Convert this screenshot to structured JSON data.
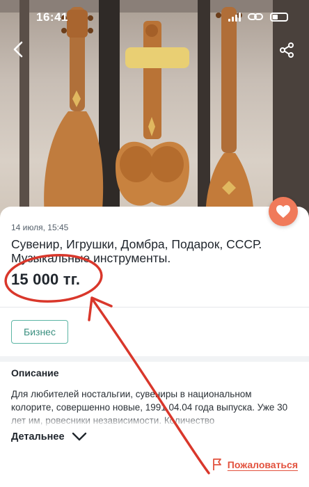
{
  "status_bar": {
    "time": "16:41"
  },
  "listing": {
    "date": "14 июля, 15:45",
    "title": "Сувенир, Игрушки, Домбра, Подарок, СССР. Музыкальные инструменты.",
    "price": "15 000 тг.",
    "badge": "Бизнес"
  },
  "description": {
    "heading": "Описание",
    "text": "Для любителей ностальгии, сувениры в национальном колорите, совершенно новые, 1991.04.04 года выпуска. Уже 30 лет им, ровесники независимости. Количество",
    "more_label": "Детальнее"
  },
  "report": {
    "label": "Пожаловаться"
  },
  "icons": {
    "back": "chevron-left-icon",
    "share": "share-icon",
    "favorite": "heart-icon",
    "more": "chevron-down-icon",
    "report": "flag-icon"
  },
  "colors": {
    "accent": "#f07a5a",
    "report": "#e2513d",
    "badge_border": "#5bb5a4",
    "annotation": "#d9372b"
  }
}
